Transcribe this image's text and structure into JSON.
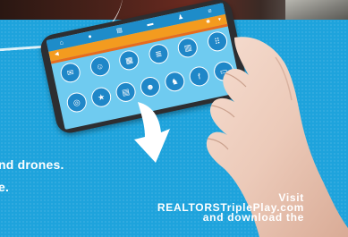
{
  "app": {
    "nav_icons": [
      "home-icon",
      "user-icon",
      "document-icon",
      "mail-icon",
      "bell-icon",
      "menu-icon"
    ],
    "title_icons": [
      "gear-icon",
      "chevron-down-icon"
    ],
    "tiles_row1": [
      {
        "icon": "message-icon",
        "glyph": "✉"
      },
      {
        "icon": "chat-icon",
        "glyph": "☺"
      },
      {
        "icon": "photo-icon",
        "glyph": "▦"
      },
      {
        "icon": "newspaper-icon",
        "glyph": "≣"
      },
      {
        "icon": "calendar-icon",
        "glyph": "▥"
      },
      {
        "icon": "grid-icon",
        "glyph": "⠿"
      }
    ],
    "tiles_row2": [
      {
        "icon": "globe-icon",
        "glyph": "◎"
      },
      {
        "icon": "star-icon",
        "glyph": "★"
      },
      {
        "icon": "document-icon",
        "glyph": "▤"
      },
      {
        "icon": "people-icon",
        "glyph": "☻"
      },
      {
        "icon": "twitter-icon",
        "glyph": "♞"
      },
      {
        "icon": "facebook-icon",
        "glyph": "f"
      },
      {
        "icon": "tablet-icon",
        "glyph": "▭"
      }
    ]
  },
  "text": {
    "left_line1": "nd drones.",
    "left_line2": "e.",
    "cta_line1": "Visit REALTORSTriplePlay.com",
    "cta_line2": "and download the"
  },
  "colors": {
    "background": "#1ea3dc",
    "navbar": "#1e8cc9",
    "titlebar": "#f39b1f",
    "accent": "#e86b1c"
  }
}
